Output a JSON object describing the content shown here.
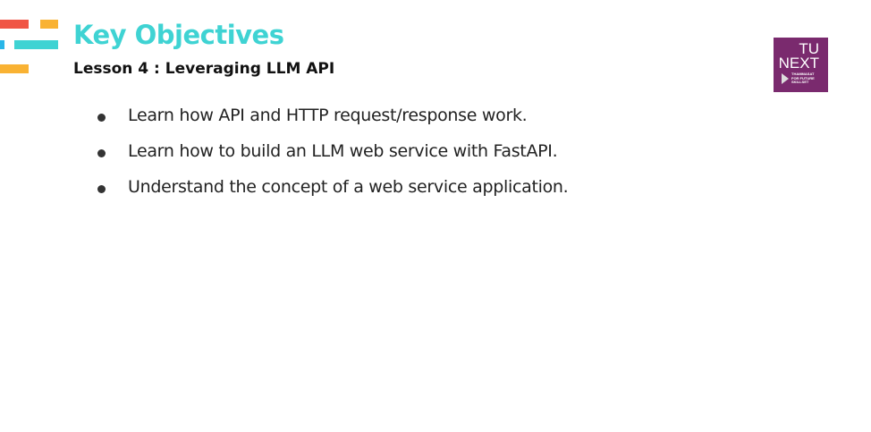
{
  "slide": {
    "title": "Key Objectives",
    "subtitle": "Lesson 4 : Leveraging LLM API",
    "bullets": [
      "Learn how API and HTTP request/response work.",
      "Learn how to build an LLM web service with FastAPI.",
      "Understand the concept of a web service application."
    ]
  },
  "logo": {
    "line1": "TU",
    "line2": "NEXT",
    "tagline": "THAMMASAT FOR FUTURE SKILLSET",
    "color": "#7a2a6e"
  },
  "colors": {
    "title": "#3fd3d3",
    "red": "#f05545",
    "orange": "#f9b233",
    "cyan": "#3fd3d3",
    "blue": "#29b6e8"
  }
}
